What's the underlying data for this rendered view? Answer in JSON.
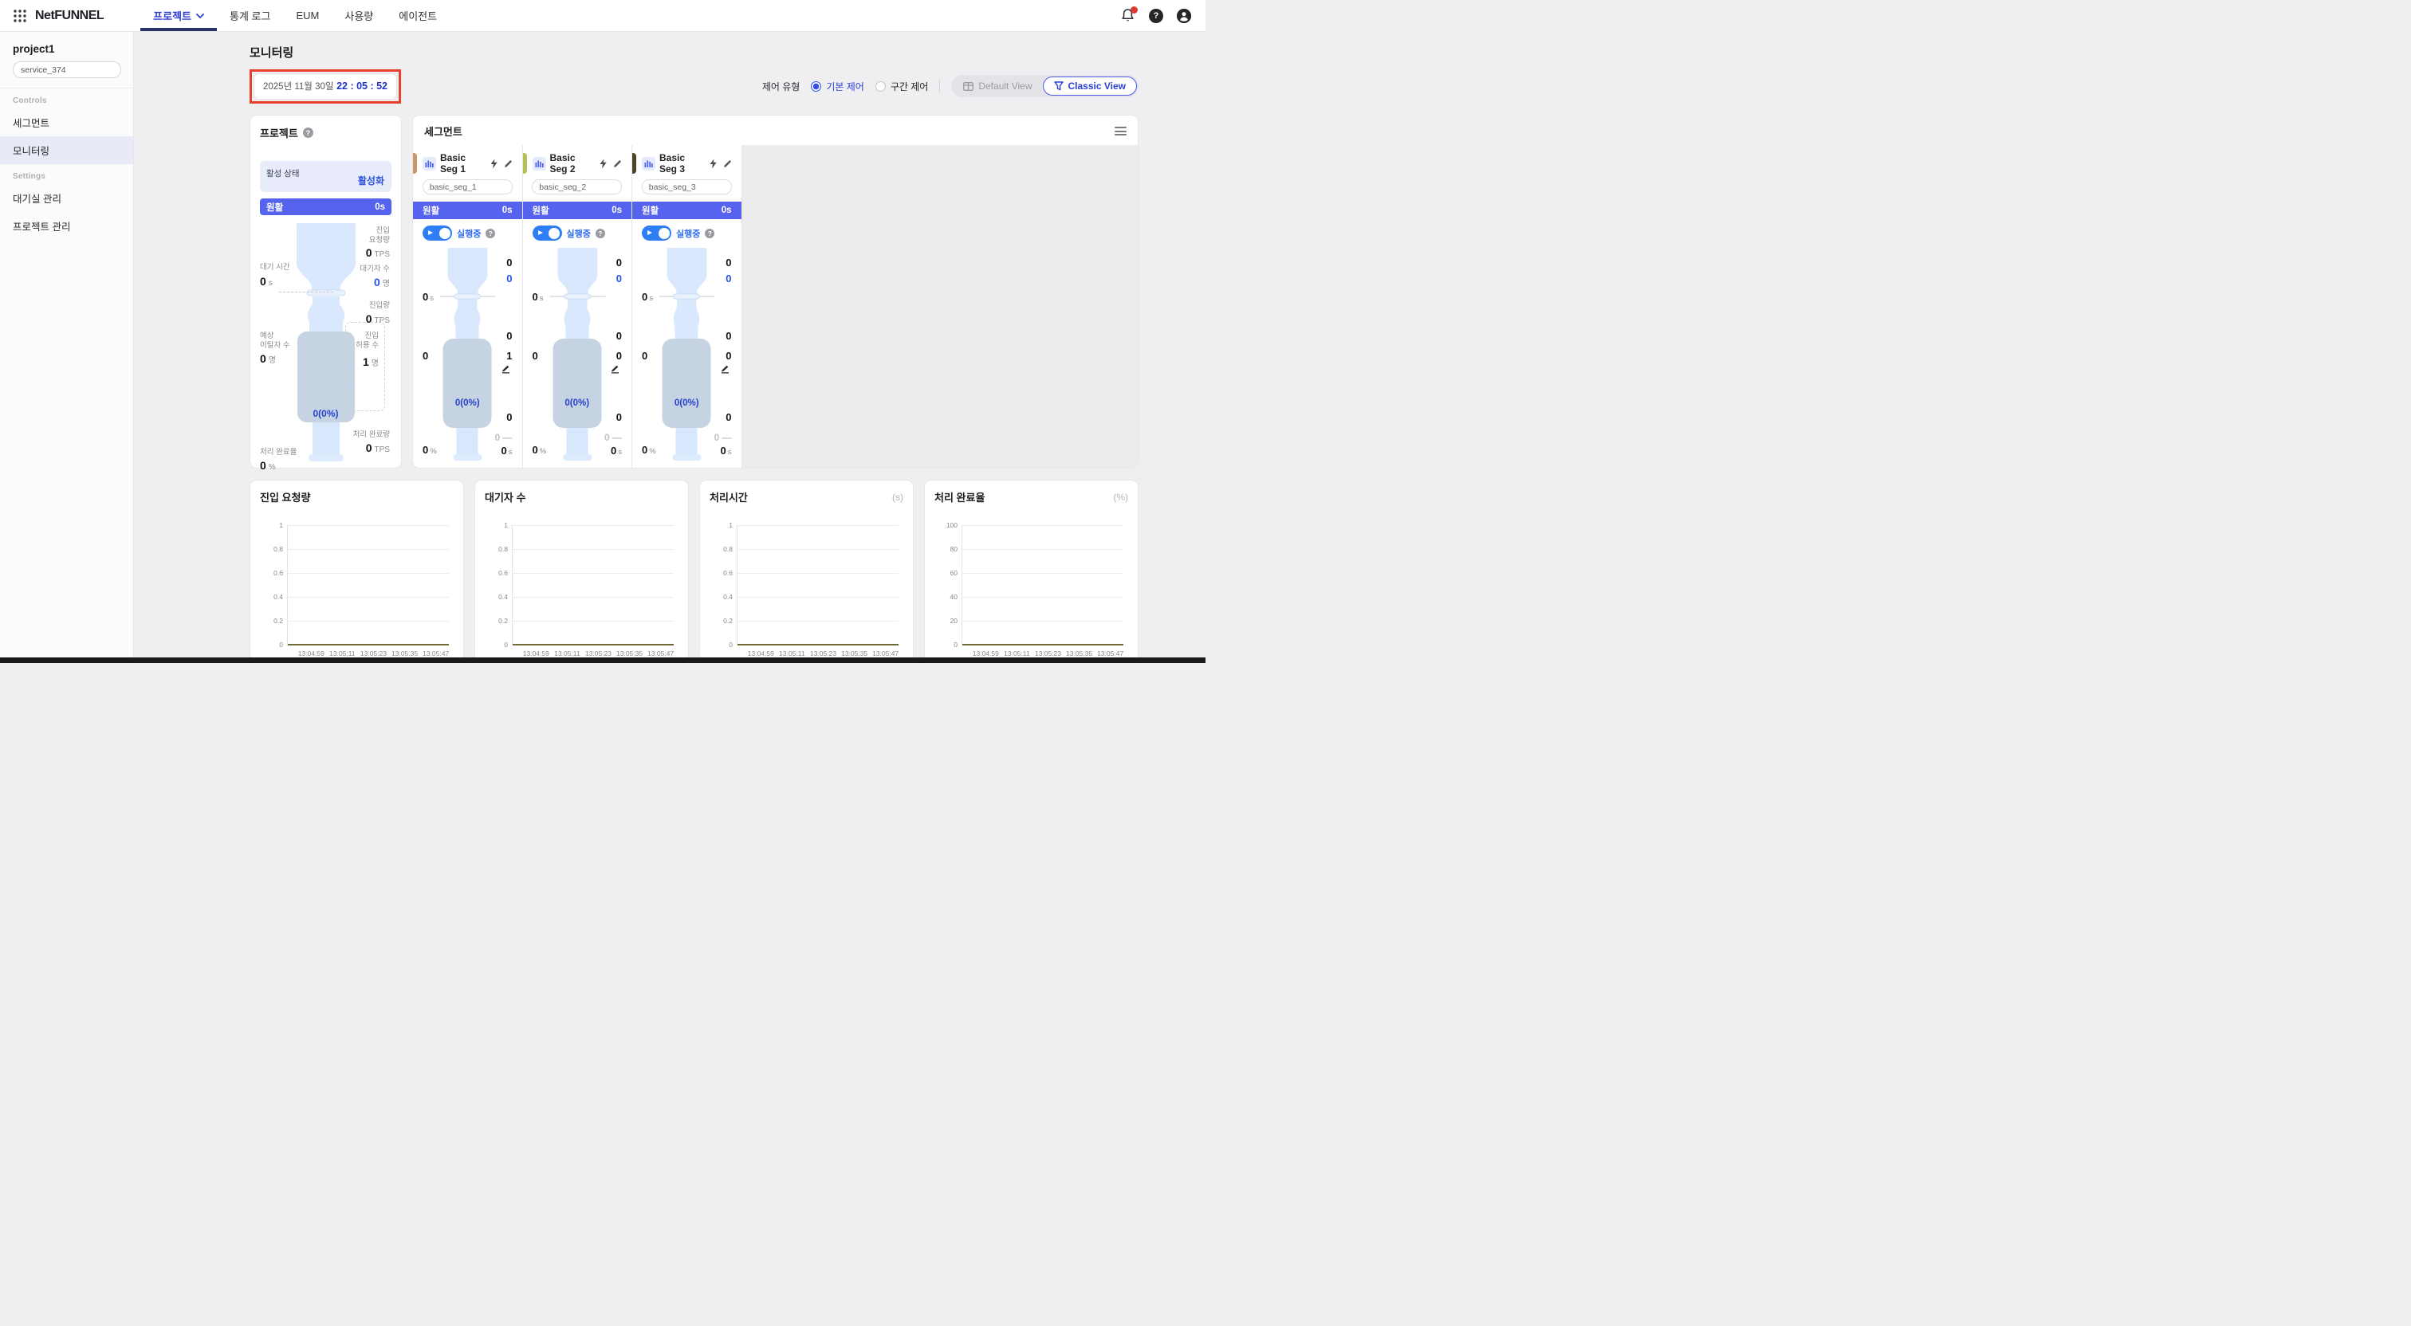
{
  "colors": {
    "accent_blue": "#2c3fd4",
    "status_blue": "#5663ee",
    "toggle_blue": "#2e7ef5",
    "highlight_red": "#e8402a",
    "chart_line": "#6f6a35"
  },
  "navbar": {
    "logo": "NetFUNNEL",
    "items": [
      {
        "label": "프로젝트",
        "active": true
      },
      {
        "label": "통계 로그",
        "active": false
      },
      {
        "label": "EUM",
        "active": false
      },
      {
        "label": "사용량",
        "active": false
      },
      {
        "label": "에이전트",
        "active": false
      }
    ]
  },
  "sidebar": {
    "project_name": "project1",
    "service_input": "service_374",
    "sections": [
      {
        "label": "Controls"
      },
      {
        "label": "Settings"
      }
    ],
    "items": {
      "segments": "세그먼트",
      "monitoring": "모니터링",
      "waiting_room": "대기실 관리",
      "project_mgmt": "프로젝트 관리"
    }
  },
  "header": {
    "title": "모니터링",
    "date": "2025년 11월 30일",
    "time": "22 : 05 : 52",
    "control_type_label": "제어 유형",
    "radios": [
      {
        "label": "기본 제어",
        "selected": true
      },
      {
        "label": "구간 제어",
        "selected": false
      }
    ],
    "view_buttons": [
      {
        "label": "Default View",
        "icon": "window-grid-icon",
        "active": false
      },
      {
        "label": "Classic View",
        "icon": "funnel-icon",
        "active": true
      }
    ]
  },
  "project_card": {
    "title": "프로젝트",
    "active_state_label": "활성 상태",
    "activate_link": "활성화",
    "status_label": "원활",
    "status_time": "0s",
    "metrics": {
      "inflow_request": {
        "label": "진입\n요청량",
        "value": "0",
        "unit": "TPS"
      },
      "waiting": {
        "label": "대기자 수",
        "value": "0",
        "unit": "명"
      },
      "wait_time": {
        "label": "대기 시간",
        "value": "0",
        "unit": "s"
      },
      "inflow": {
        "label": "진입량",
        "value": "0",
        "unit": "TPS"
      },
      "expected_exit": {
        "label": "예상\n이탈자 수",
        "value": "0",
        "unit": "명"
      },
      "allowed": {
        "label": "진입\n허용 수",
        "value": "1",
        "unit": "명"
      },
      "pool": "0(0%)",
      "completed": {
        "label": "처리 완료량",
        "value": "0",
        "unit": "TPS"
      },
      "rate": {
        "label": "처리 완료율",
        "value": "0",
        "unit": "%"
      }
    }
  },
  "segment_card": {
    "title": "세그먼트",
    "status_label": "원활",
    "status_time": "0s",
    "running_label": "실행중",
    "segments": [
      {
        "name": "Basic Seg 1",
        "key": "basic_seg_1",
        "strip_color": "#c8976b",
        "values": {
          "inflow_request": "0",
          "waiting": "0",
          "wait_time": "0",
          "wait_time_unit": "s",
          "inflow": "0",
          "expected_exit": "0",
          "allowed": "1",
          "pool": "0(0%)",
          "completed": "0",
          "pending": "0",
          "pending_trend": "—",
          "rate": "0",
          "rate_unit": "%",
          "proc_time": "0",
          "proc_time_unit": "s"
        }
      },
      {
        "name": "Basic Seg 2",
        "key": "basic_seg_2",
        "strip_color": "#b8c054",
        "values": {
          "inflow_request": "0",
          "waiting": "0",
          "wait_time": "0",
          "wait_time_unit": "s",
          "inflow": "0",
          "expected_exit": "0",
          "allowed": "0",
          "pool": "0(0%)",
          "completed": "0",
          "pending": "0",
          "pending_trend": "—",
          "rate": "0",
          "rate_unit": "%",
          "proc_time": "0",
          "proc_time_unit": "s"
        }
      },
      {
        "name": "Basic Seg 3",
        "key": "basic_seg_3",
        "strip_color": "#4c4426",
        "values": {
          "inflow_request": "0",
          "waiting": "0",
          "wait_time": "0",
          "wait_time_unit": "s",
          "inflow": "0",
          "expected_exit": "0",
          "allowed": "0",
          "pool": "0(0%)",
          "completed": "0",
          "pending": "0",
          "pending_trend": "—",
          "rate": "0",
          "rate_unit": "%",
          "proc_time": "0",
          "proc_time_unit": "s"
        }
      }
    ]
  },
  "chart_data": [
    {
      "type": "line",
      "title": "진입 요청량",
      "unit": "",
      "x": [
        "13:04:59",
        "13:05:11",
        "13:05:23",
        "13:05:35",
        "13:05:47"
      ],
      "series": [
        {
          "name": "value",
          "values": [
            0,
            0,
            0,
            0,
            0
          ]
        }
      ],
      "ylim": [
        0,
        1
      ],
      "yticks": [
        0,
        0.2,
        0.4,
        0.6,
        0.8,
        1
      ],
      "grid": true,
      "legend": "none",
      "line_color": "#6f6a35"
    },
    {
      "type": "line",
      "title": "대기자 수",
      "unit": "",
      "x": [
        "13:04:59",
        "13:05:11",
        "13:05:23",
        "13:05:35",
        "13:05:47"
      ],
      "series": [
        {
          "name": "value",
          "values": [
            0,
            0,
            0,
            0,
            0
          ]
        }
      ],
      "ylim": [
        0,
        1
      ],
      "yticks": [
        0,
        0.2,
        0.4,
        0.6,
        0.8,
        1
      ],
      "grid": true,
      "legend": "none",
      "line_color": "#6f6a35"
    },
    {
      "type": "line",
      "title": "처리시간",
      "unit": "(s)",
      "x": [
        "13:04:59",
        "13:05:11",
        "13:05:23",
        "13:05:35",
        "13:05:47"
      ],
      "series": [
        {
          "name": "value",
          "values": [
            0,
            0,
            0,
            0,
            0
          ]
        }
      ],
      "ylim": [
        0,
        1
      ],
      "yticks": [
        0,
        0.2,
        0.4,
        0.6,
        0.8,
        1
      ],
      "grid": true,
      "legend": "none",
      "line_color": "#6f6a35"
    },
    {
      "type": "line",
      "title": "처리 완료율",
      "unit": "(%)",
      "x": [
        "13:04:59",
        "13:05:11",
        "13:05:23",
        "13:05:35",
        "13:05:47"
      ],
      "series": [
        {
          "name": "value",
          "values": [
            0,
            0,
            0,
            0,
            0
          ]
        }
      ],
      "ylim": [
        0,
        100
      ],
      "yticks": [
        0,
        20,
        40,
        60,
        80,
        100
      ],
      "grid": true,
      "legend": "none",
      "line_color": "#6f6a35"
    }
  ]
}
